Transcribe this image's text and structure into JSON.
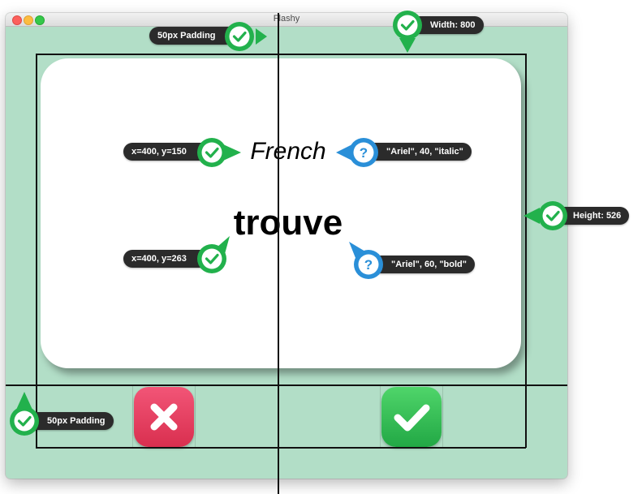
{
  "window": {
    "title": "Flashy"
  },
  "card": {
    "title": "French",
    "word": "trouve",
    "background": "#ffffff"
  },
  "buttons": {
    "wrong": {
      "color": "#e0405e",
      "icon": "close-icon"
    },
    "right": {
      "color": "#2fbf55",
      "icon": "checkmark-icon"
    }
  },
  "annotations": {
    "top_padding": "50px Padding",
    "width": "Width: 800",
    "height": "Height: 526",
    "title_pos": "x=400, y=150",
    "title_font": "\"Ariel\", 40, \"italic\"",
    "word_pos": "x=400, y=263",
    "word_font": "\"Ariel\", 60, \"bold\"",
    "bottom_padding": "50px Padding"
  },
  "colors": {
    "window_bg": "#b2dec7",
    "check_green": "#22b14c",
    "question_blue": "#2a8fd8",
    "pill_bg": "#2b2b2b"
  }
}
